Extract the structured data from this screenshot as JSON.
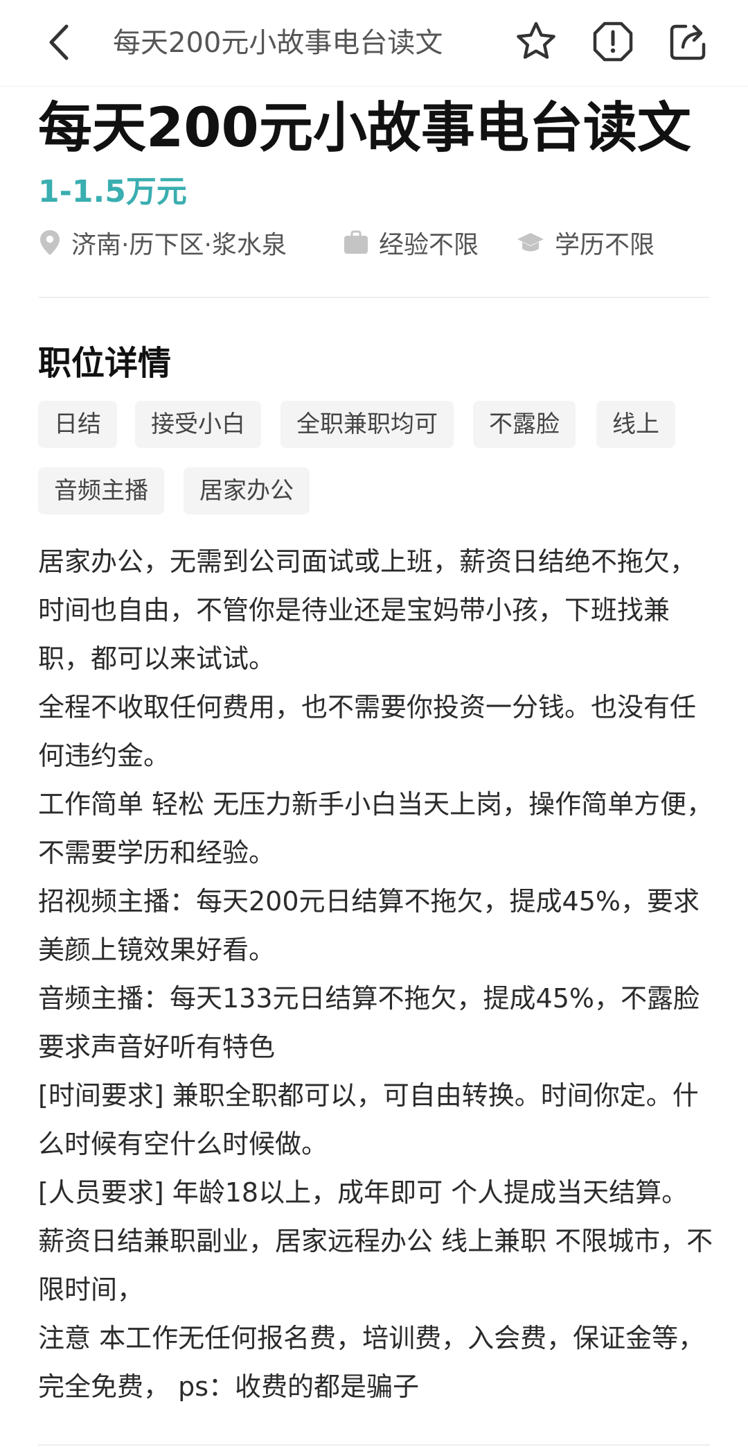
{
  "nav": {
    "title": "每天200元小故事电台读文",
    "icons": [
      "back-icon",
      "star-icon",
      "alert-icon",
      "share-icon"
    ]
  },
  "job": {
    "title": "每天200元小故事电台读文",
    "salary": "1-1.5万元",
    "location": "济南·历下区·浆水泉",
    "experience": "经验不限",
    "education": "学历不限"
  },
  "details": {
    "section_title": "职位详情",
    "tags": [
      "日结",
      "接受小白",
      "全职兼职均可",
      "不露脸",
      "线上",
      "音频主播",
      "居家办公"
    ],
    "paragraphs": [
      "居家办公，无需到公司面试或上班，薪资日结绝不拖欠，时间也自由，不管你是待业还是宝妈带小孩，下班找兼职，都可以来试试。",
      "全程不收取任何费用，也不需要你投资一分钱。也没有任何违约金。",
      "工作简单 轻松 无压力新手小白当天上岗，操作简单方便，不需要学历和经验。",
      "招视频主播：每天200元日结算不拖欠，提成45%，要求美颜上镜效果好看。",
      "音频主播：每天133元日结算不拖欠，提成45%，不露脸要求声音好听有特色",
      "[时间要求] 兼职全职都可以，可自由转换。时间你定。什么时候有空什么时候做。",
      "[人员要求] 年龄18以上，成年即可 个人提成当天结算。 薪资日结兼职副业，居家远程办公 线上兼职 不限城市，不限时间，",
      "注意 本工作无任何报名费，培训费，入会费，保证金等，完全免费， ps：收费的都是骗子"
    ]
  },
  "colors": {
    "salary": "#3aaeb0",
    "tag_bg": "#f4f4f4",
    "text": "#2b2b2b",
    "muted": "#555555"
  }
}
